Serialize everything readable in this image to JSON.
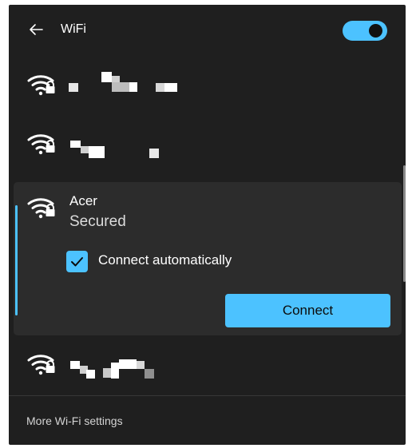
{
  "header": {
    "title": "WiFi",
    "back_icon": "back-arrow-icon",
    "toggle_state": "on"
  },
  "networks": [
    {
      "id": "network-1",
      "ssid": "",
      "security": "",
      "icon": "wifi-secured-icon"
    },
    {
      "id": "network-2",
      "ssid": "",
      "security": "",
      "icon": "wifi-secured-icon"
    },
    {
      "id": "network-acer",
      "ssid": "Acer",
      "security": "Secured",
      "icon": "wifi-secured-icon"
    },
    {
      "id": "network-4",
      "ssid": "",
      "security": "",
      "icon": "wifi-secured-icon"
    }
  ],
  "active_network": {
    "ssid": "Acer",
    "status": "Secured",
    "connect_automatically_label": "Connect automatically",
    "connect_automatically_checked": true,
    "connect_label": "Connect"
  },
  "footer": {
    "more_label": "More Wi-Fi settings"
  },
  "colors": {
    "accent": "#4cc2ff",
    "panel_bg": "#1f1f1f",
    "selected_bg": "#2c2c2c",
    "text": "#ffffff"
  }
}
